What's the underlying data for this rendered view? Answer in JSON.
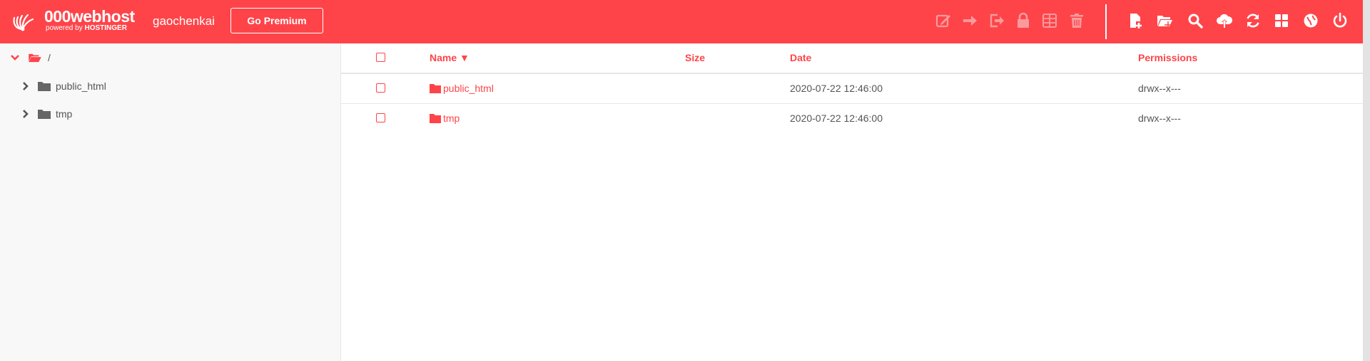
{
  "brand": {
    "name": "000webhost",
    "sub_prefix": "powered by",
    "sub_company": "HOSTINGER",
    "accent": "#fe4449"
  },
  "user": {
    "name": "gaochenkai"
  },
  "header": {
    "premium_label": "Go Premium"
  },
  "toolbar": {
    "disabled": [
      "edit-icon",
      "move-icon",
      "export-icon",
      "lock-icon",
      "archive-icon",
      "trash-icon"
    ],
    "enabled": [
      "new-file-icon",
      "new-folder-icon",
      "search-icon",
      "upload-cloud-icon",
      "refresh-icon",
      "grid-view-icon",
      "globe-icon",
      "power-icon"
    ]
  },
  "sidebar": {
    "root_label": "/",
    "items": [
      {
        "label": "public_html"
      },
      {
        "label": "tmp"
      }
    ]
  },
  "table": {
    "headers": {
      "name": "Name ▼",
      "size": "Size",
      "date": "Date",
      "permissions": "Permissions"
    },
    "rows": [
      {
        "name": "public_html",
        "size": "",
        "date": "2020-07-22 12:46:00",
        "permissions": "drwx--x---"
      },
      {
        "name": "tmp",
        "size": "",
        "date": "2020-07-22 12:46:00",
        "permissions": "drwx--x---"
      }
    ]
  }
}
